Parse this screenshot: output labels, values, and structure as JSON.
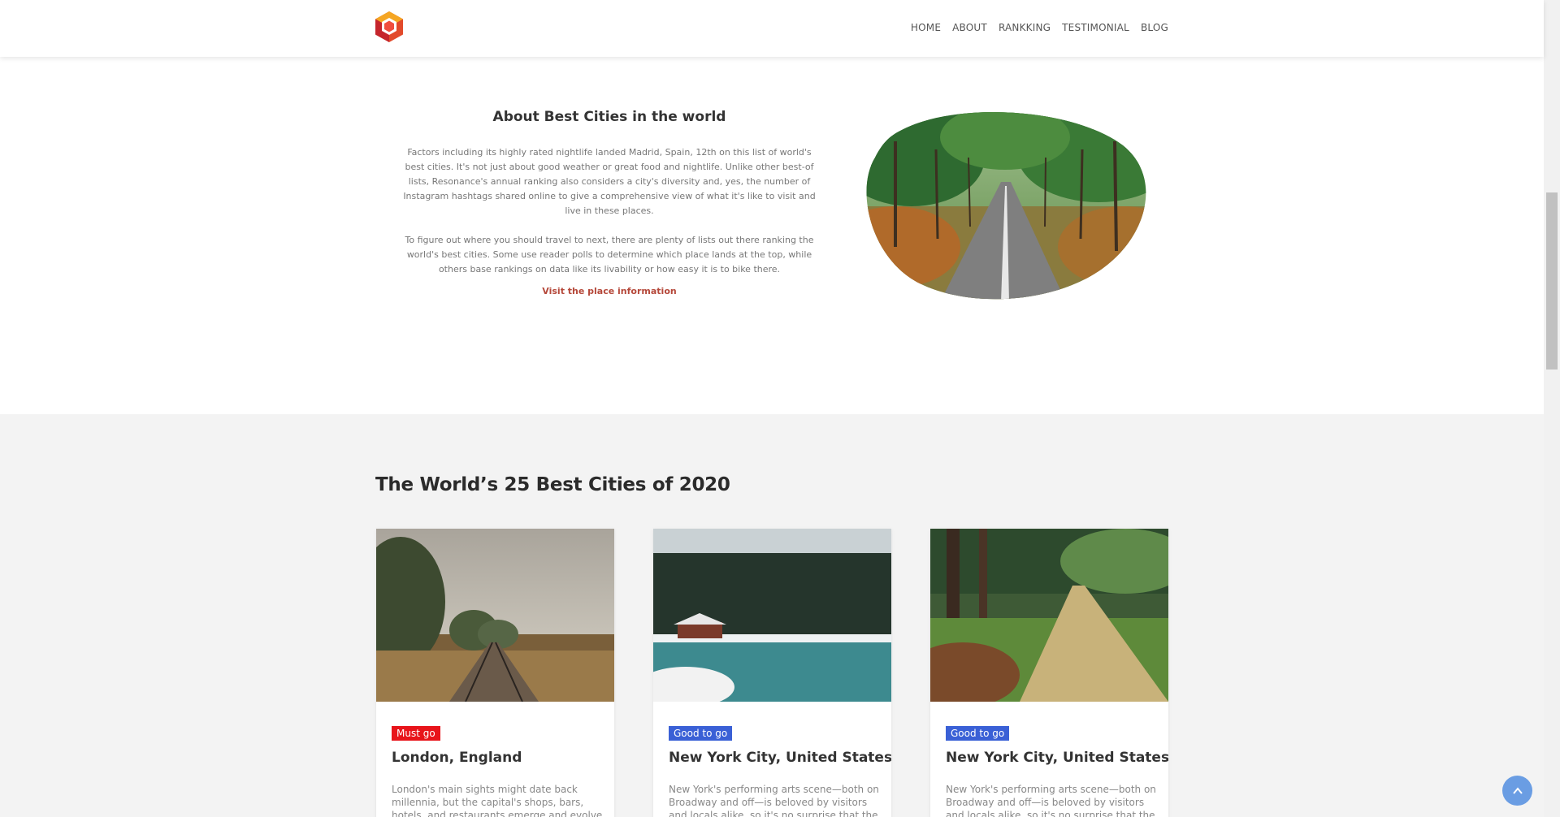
{
  "nav": {
    "items": [
      "HOME",
      "ABOUT",
      "RANKKING",
      "TESTIMONIAL",
      "BLOG"
    ]
  },
  "about": {
    "title": "About Best Cities in the world",
    "paragraph1": "Factors including its highly rated nightlife landed Madrid, Spain, 12th on this list of world's best cities. It's not just about good weather or great food and nightlife. Unlike other best-of lists, Resonance's annual ranking also considers a city's diversity and, yes, the number of Instagram hashtags shared online to give a comprehensive view of what it's like to visit and live in these places.",
    "paragraph2": "To figure out where you should travel to next, there are plenty of lists out there ranking the world's best cities. Some use reader polls to determine which place lands at the top, while others base rankings on data like its livability or how easy it is to bike there.",
    "link": "Visit the place information"
  },
  "cities": {
    "title": "The World’s 25 Best Cities of 2020",
    "cards": [
      {
        "badge": "Must go",
        "title": "London, England",
        "text": "London's main sights might date back millennia, but the capital's shops, bars, hotels, and restaurants emerge and evolve"
      },
      {
        "badge": "Good to go",
        "title": "New York City, United States",
        "text": "New York's performing arts scene—both on Broadway and off—is beloved by visitors and locals alike, so it's no surprise that the"
      },
      {
        "badge": "Good to go",
        "title": "New York City, United States",
        "text": "New York's performing arts scene—both on Broadway and off—is beloved by visitors and locals alike, so it's no surprise that the"
      }
    ]
  },
  "colors": {
    "accent_link": "#b5483a",
    "badge_must": "#e8141a",
    "badge_good": "#3a60d6",
    "scroll_top": "#6a9de3"
  },
  "icons": {
    "logo": "hexagon-logo-icon",
    "scroll_top": "chevron-up-icon"
  }
}
